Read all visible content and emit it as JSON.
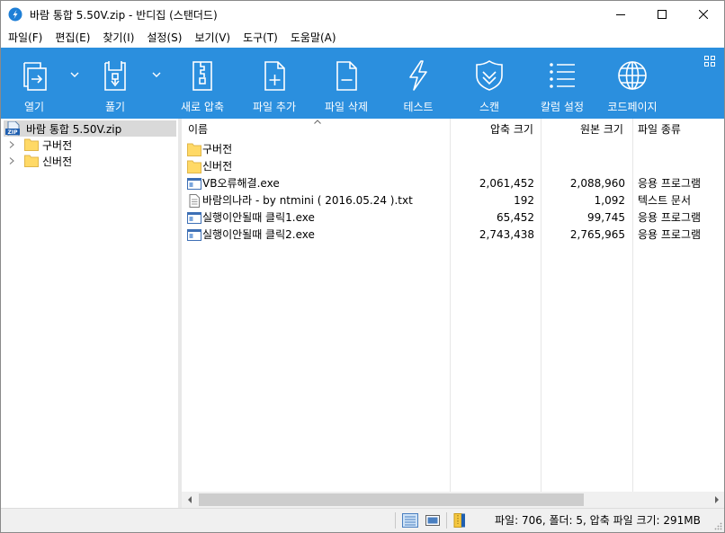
{
  "window": {
    "title": "바람 통합 5.50V.zip - 반디집 (스탠더드)",
    "accent_color": "#2b8fde"
  },
  "menu": [
    {
      "label": "파일(F)"
    },
    {
      "label": "편집(E)"
    },
    {
      "label": "찾기(I)"
    },
    {
      "label": "설정(S)"
    },
    {
      "label": "보기(V)"
    },
    {
      "label": "도구(T)"
    },
    {
      "label": "도움말(A)"
    }
  ],
  "toolbar": {
    "open": "열기",
    "extract": "풀기",
    "new_archive": "새로 압축",
    "add_file": "파일 추가",
    "delete_file": "파일 삭제",
    "test": "테스트",
    "scan": "스캔",
    "columns": "칼럼 설정",
    "codepage": "코드페이지"
  },
  "tree": {
    "root": "바람 통합 5.50V.zip",
    "items": [
      {
        "label": "구버전"
      },
      {
        "label": "신버전"
      }
    ]
  },
  "columns": {
    "name": "이름",
    "compressed": "압축 크기",
    "original": "원본 크기",
    "type": "파일 종류"
  },
  "files": [
    {
      "name": "구버전",
      "compressed": "",
      "original": "",
      "type": "",
      "icon": "folder-icon"
    },
    {
      "name": "신버전",
      "compressed": "",
      "original": "",
      "type": "",
      "icon": "folder-icon"
    },
    {
      "name": "VB오류해결.exe",
      "compressed": "2,061,452",
      "original": "2,088,960",
      "type": "응용 프로그램",
      "icon": "exe-icon"
    },
    {
      "name": "바람의나라 - by ntmini ( 2016.05.24 ).txt",
      "compressed": "192",
      "original": "1,092",
      "type": "텍스트 문서",
      "icon": "text-file-icon"
    },
    {
      "name": "실행이안될때 클릭1.exe",
      "compressed": "65,452",
      "original": "99,745",
      "type": "응용 프로그램",
      "icon": "exe-icon"
    },
    {
      "name": "실행이안될때 클릭2.exe",
      "compressed": "2,743,438",
      "original": "2,765,965",
      "type": "응용 프로그램",
      "icon": "exe-icon"
    }
  ],
  "status": {
    "summary": "파일: 706, 폴더: 5, 압축 파일 크기: 291MB"
  }
}
